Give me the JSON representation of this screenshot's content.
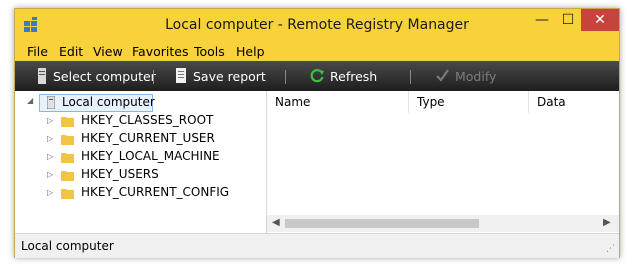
{
  "window": {
    "title": "Local computer - Remote Registry Manager"
  },
  "title_buttons": {
    "minimize": "—",
    "maximize": "☐",
    "close": "✕"
  },
  "menu": [
    "File",
    "Edit",
    "View",
    "Favorites",
    "Tools",
    "Help"
  ],
  "toolbar": {
    "select_computer": "Select computer",
    "save_report": "Save report",
    "refresh": "Refresh",
    "modify": "Modify"
  },
  "tree": {
    "root": "Local computer",
    "hives": [
      "HKEY_CLASSES_ROOT",
      "HKEY_CURRENT_USER",
      "HKEY_LOCAL_MACHINE",
      "HKEY_USERS",
      "HKEY_CURRENT_CONFIG"
    ]
  },
  "list": {
    "columns": [
      "Name",
      "Type",
      "Data"
    ]
  },
  "status": {
    "text": "Local computer"
  },
  "colors": {
    "titlebar": "#f7d23a",
    "toolbar": "#2a2a2a",
    "close": "#c7443e",
    "selection": "#88b6e6"
  }
}
